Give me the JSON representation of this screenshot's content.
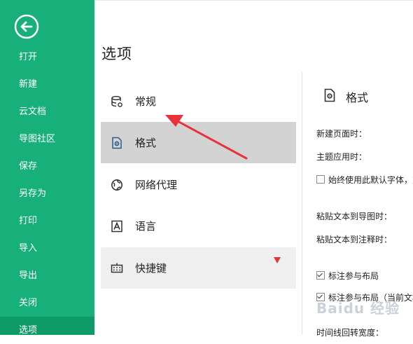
{
  "sidebar": {
    "items": [
      {
        "label": "打开"
      },
      {
        "label": "新建"
      },
      {
        "label": "云文档"
      },
      {
        "label": "导图社区"
      },
      {
        "label": "保存"
      },
      {
        "label": "另存为"
      },
      {
        "label": "打印"
      },
      {
        "label": "导入"
      },
      {
        "label": "导出"
      },
      {
        "label": "关闭"
      },
      {
        "label": "选项"
      }
    ]
  },
  "page": {
    "title": "选项"
  },
  "categories": [
    {
      "label": "常规",
      "icon": "database-icon"
    },
    {
      "label": "格式",
      "icon": "document-gear-icon"
    },
    {
      "label": "网络代理",
      "icon": "globe-icon"
    },
    {
      "label": "语言",
      "icon": "text-a-icon"
    },
    {
      "label": "快捷键",
      "icon": "keyboard-icon"
    }
  ],
  "panel": {
    "title": "格式",
    "options": {
      "new_page": "新建页面时：",
      "theme_apply": "主题应用时：",
      "always_default_font": "始终使用此默认字体，对",
      "paste_text_map": "粘贴文本到导图时：",
      "paste_text_note": "粘贴文本到注释时：",
      "label_layout": "标注参与布局",
      "label_layout_current": "标注参与布局（当前文档",
      "timeline_width": "时间线回转宽度："
    }
  },
  "watermark": {
    "text": "Baidu 经验"
  },
  "colors": {
    "sidebar": "#17b07a",
    "sidebar_active": "#0f9b68",
    "annotation": "#e8323c"
  }
}
